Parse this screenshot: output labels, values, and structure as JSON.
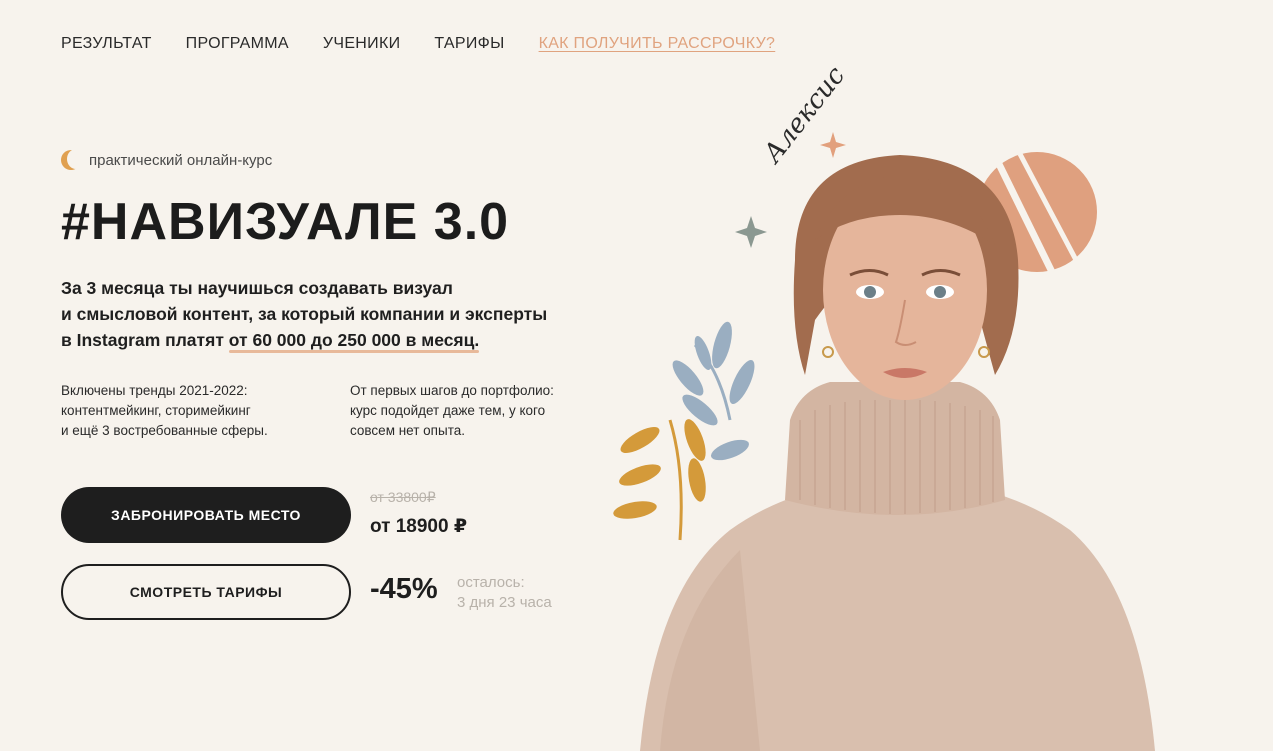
{
  "nav": {
    "items": [
      "РЕЗУЛЬТАТ",
      "ПРОГРАММА",
      "УЧЕНИКИ",
      "ТАРИФЫ"
    ],
    "accent_link": "КАК ПОЛУЧИТЬ РАССРОЧКУ?"
  },
  "hero": {
    "badge": "практический онлайн-курс",
    "title": "#НАВИЗУАЛЕ 3.0",
    "lead_1": "За 3 месяца ты научишься создавать визуал",
    "lead_2": "и смысловой контент, за который компании и эксперты",
    "lead_3": "в Instagram платят",
    "lead_highlight": "от 60 000 до 250 000 в месяц.",
    "col1_1": "Включены тренды 2021-2022:",
    "col1_2": "контентмейкинг, сторимейкинг",
    "col1_3": "и ещё 3 востребованные сферы.",
    "col2_1": "От первых шагов до портфолио:",
    "col2_2": "курс подойдет даже тем, у кого",
    "col2_3": "совсем нет опыта."
  },
  "cta": {
    "primary": "ЗАБРОНИРОВАТЬ МЕСТО",
    "secondary": "СМОТРЕТЬ ТАРИФЫ"
  },
  "price": {
    "old": "от 33800₽",
    "new": "от 18900 ₽",
    "discount": "-45%",
    "left_label": "осталось:",
    "left_time": "3 дня 23 часа"
  },
  "art": {
    "signature": "Алексис"
  },
  "colors": {
    "background": "#f7f3ed",
    "accent": "#e0a37f",
    "dark": "#1e1e1e",
    "sweater": "#d9bfae"
  }
}
